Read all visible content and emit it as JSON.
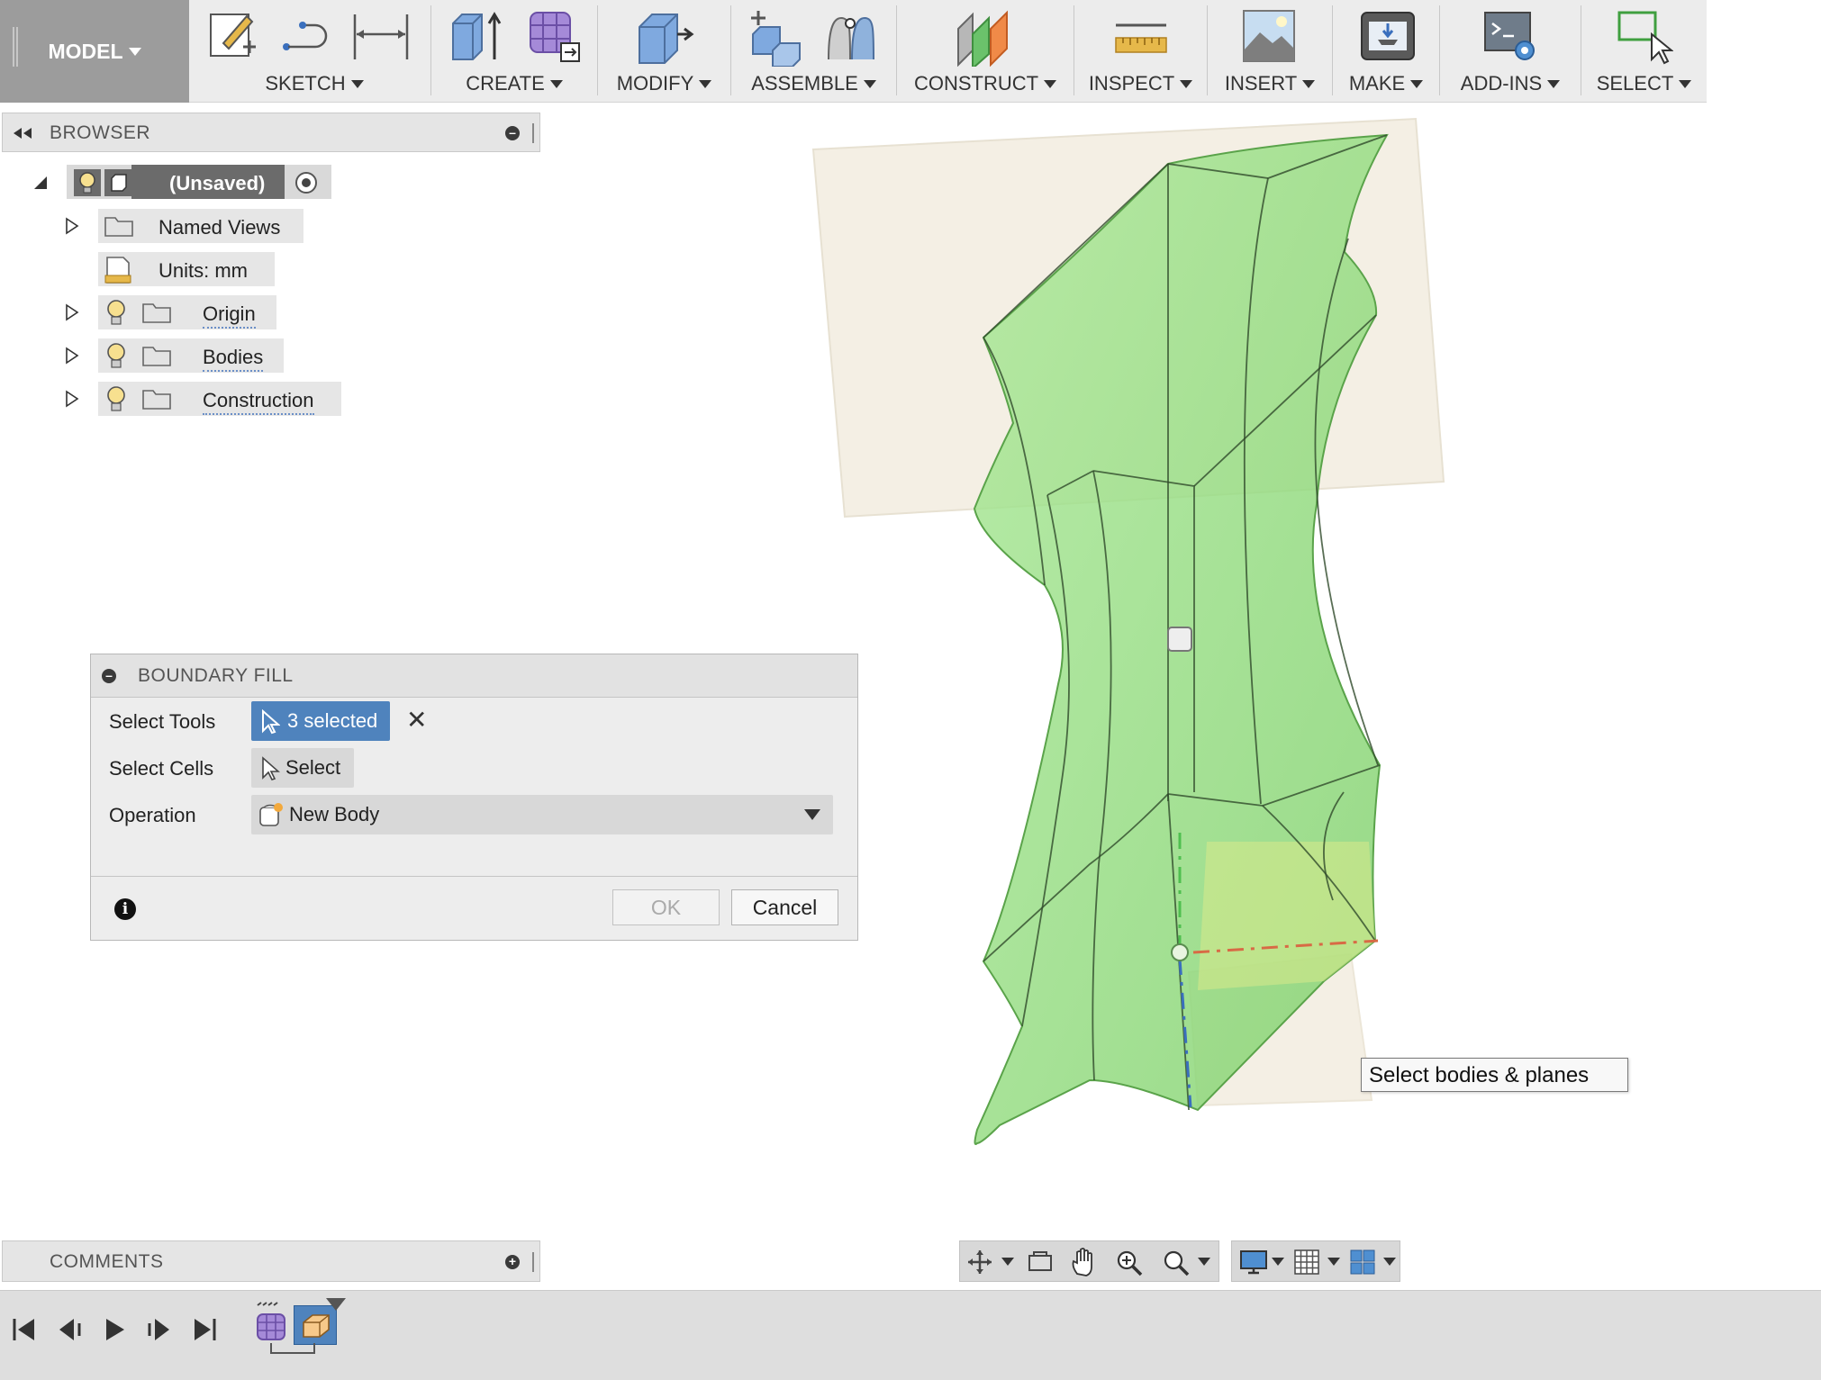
{
  "toolbar": {
    "workspace_label": "MODEL",
    "groups": [
      {
        "label": "SKETCH"
      },
      {
        "label": "CREATE"
      },
      {
        "label": "MODIFY"
      },
      {
        "label": "ASSEMBLE"
      },
      {
        "label": "CONSTRUCT"
      },
      {
        "label": "INSPECT"
      },
      {
        "label": "INSERT"
      },
      {
        "label": "MAKE"
      },
      {
        "label": "ADD-INS"
      },
      {
        "label": "SELECT"
      }
    ]
  },
  "browser": {
    "title": "BROWSER",
    "root_label": "(Unsaved)",
    "items": [
      {
        "label": "Named Views",
        "icon": "folder-icon"
      },
      {
        "label": "Units: mm",
        "icon": "units-icon"
      },
      {
        "label": "Origin",
        "icon": "folder-icon"
      },
      {
        "label": "Bodies",
        "icon": "folder-icon"
      },
      {
        "label": "Construction",
        "icon": "folder-icon"
      }
    ]
  },
  "dialog": {
    "title": "BOUNDARY FILL",
    "select_tools_label": "Select Tools",
    "select_tools_value": "3 selected",
    "select_cells_label": "Select Cells",
    "select_cells_value": "Select",
    "operation_label": "Operation",
    "operation_value": "New Body",
    "ok_label": "OK",
    "cancel_label": "Cancel"
  },
  "tooltip": "Select bodies & planes",
  "comments": {
    "title": "COMMENTS"
  },
  "colors": {
    "accent_blue": "#4f83bd",
    "body_green": "#8fdc7d",
    "plane_beige": "#f3ede0",
    "workspace_gray": "#9c9c9c"
  }
}
